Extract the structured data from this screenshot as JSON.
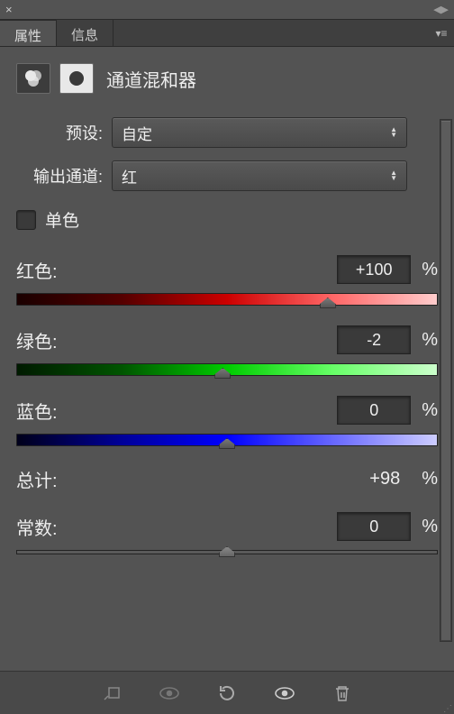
{
  "tabs": {
    "properties": "属性",
    "info": "信息"
  },
  "title": "通道混和器",
  "preset": {
    "label": "预设:",
    "value": "自定"
  },
  "output_channel": {
    "label": "输出通道:",
    "value": "红"
  },
  "monochrome": {
    "label": "单色",
    "checked": false
  },
  "channels": {
    "red": {
      "label": "红色:",
      "value": "+100",
      "percent": "%",
      "pos": 74
    },
    "green": {
      "label": "绿色:",
      "value": "-2",
      "percent": "%",
      "pos": 49
    },
    "blue": {
      "label": "蓝色:",
      "value": "0",
      "percent": "%",
      "pos": 50
    }
  },
  "total": {
    "label": "总计:",
    "value": "+98",
    "percent": "%"
  },
  "constant": {
    "label": "常数:",
    "value": "0",
    "percent": "%",
    "pos": 50
  }
}
